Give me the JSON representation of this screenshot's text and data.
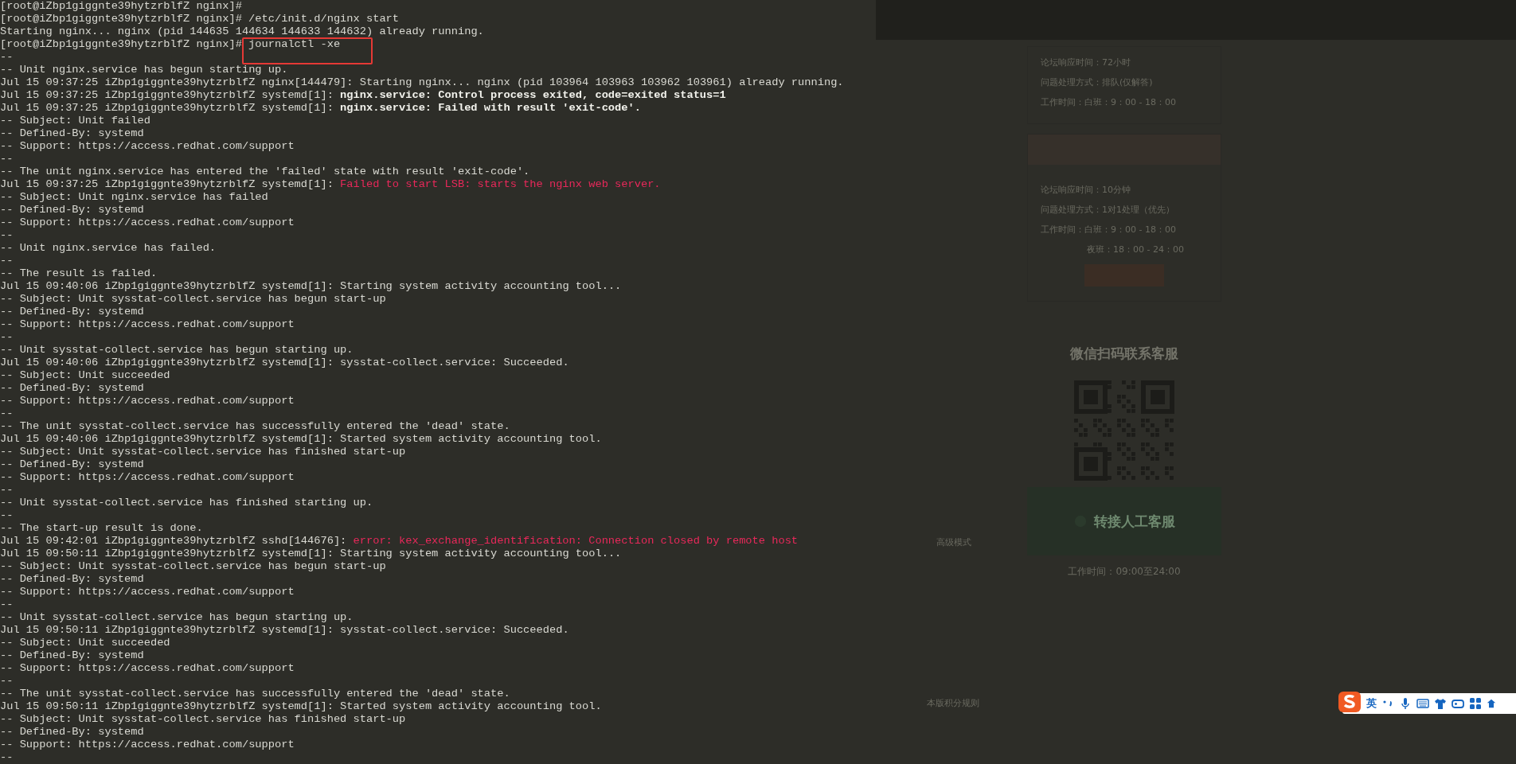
{
  "terminal": {
    "lines": [
      {
        "kind": "prompt",
        "prompt": "[root@iZbp1giggnte39hytzrblfZ nginx]#"
      },
      {
        "kind": "prompt",
        "prompt": "[root@iZbp1giggnte39hytzrblfZ nginx]#",
        "command": "/etc/init.d/nginx start",
        "boxed": false
      },
      {
        "kind": "output",
        "text": "Starting nginx... nginx (pid 144635 144634 144633 144632) already running."
      },
      {
        "kind": "prompt",
        "prompt": "[root@iZbp1giggnte39hytzrblfZ nginx]#",
        "command": "journalctl -xe",
        "boxed": true
      },
      {
        "kind": "output",
        "text": "--"
      },
      {
        "kind": "output",
        "text": "-- Unit nginx.service has begun starting up."
      },
      {
        "kind": "output",
        "text": "Jul 15 09:37:25 iZbp1giggnte39hytzrblfZ nginx[144479]: Starting nginx... nginx (pid 103964 103963 103962 103961) already running."
      },
      {
        "kind": "log",
        "prefix": "Jul 15 09:37:25 iZbp1giggnte39hytzrblfZ systemd[1]:",
        "message": "nginx.service: Control process exited, code=exited status=1",
        "bold": true,
        "error": false
      },
      {
        "kind": "log",
        "prefix": "Jul 15 09:37:25 iZbp1giggnte39hytzrblfZ systemd[1]:",
        "message": "nginx.service: Failed with result 'exit-code'.",
        "bold": true,
        "error": false
      },
      {
        "kind": "output",
        "text": "-- Subject: Unit failed"
      },
      {
        "kind": "output",
        "text": "-- Defined-By: systemd"
      },
      {
        "kind": "output",
        "text": "-- Support: https://access.redhat.com/support"
      },
      {
        "kind": "output",
        "text": "--"
      },
      {
        "kind": "output",
        "text": "-- The unit nginx.service has entered the 'failed' state with result 'exit-code'."
      },
      {
        "kind": "log",
        "prefix": "Jul 15 09:37:25 iZbp1giggnte39hytzrblfZ systemd[1]:",
        "message": "Failed to start LSB: starts the nginx web server.",
        "bold": false,
        "error": true
      },
      {
        "kind": "output",
        "text": "-- Subject: Unit nginx.service has failed"
      },
      {
        "kind": "output",
        "text": "-- Defined-By: systemd"
      },
      {
        "kind": "output",
        "text": "-- Support: https://access.redhat.com/support"
      },
      {
        "kind": "output",
        "text": "--"
      },
      {
        "kind": "output",
        "text": "-- Unit nginx.service has failed."
      },
      {
        "kind": "output",
        "text": "--"
      },
      {
        "kind": "output",
        "text": "-- The result is failed."
      },
      {
        "kind": "output",
        "text": "Jul 15 09:40:06 iZbp1giggnte39hytzrblfZ systemd[1]: Starting system activity accounting tool..."
      },
      {
        "kind": "output",
        "text": "-- Subject: Unit sysstat-collect.service has begun start-up"
      },
      {
        "kind": "output",
        "text": "-- Defined-By: systemd"
      },
      {
        "kind": "output",
        "text": "-- Support: https://access.redhat.com/support"
      },
      {
        "kind": "output",
        "text": "--"
      },
      {
        "kind": "output",
        "text": "-- Unit sysstat-collect.service has begun starting up."
      },
      {
        "kind": "output",
        "text": "Jul 15 09:40:06 iZbp1giggnte39hytzrblfZ systemd[1]: sysstat-collect.service: Succeeded."
      },
      {
        "kind": "output",
        "text": "-- Subject: Unit succeeded"
      },
      {
        "kind": "output",
        "text": "-- Defined-By: systemd"
      },
      {
        "kind": "output",
        "text": "-- Support: https://access.redhat.com/support"
      },
      {
        "kind": "output",
        "text": "--"
      },
      {
        "kind": "output",
        "text": "-- The unit sysstat-collect.service has successfully entered the 'dead' state."
      },
      {
        "kind": "output",
        "text": "Jul 15 09:40:06 iZbp1giggnte39hytzrblfZ systemd[1]: Started system activity accounting tool."
      },
      {
        "kind": "output",
        "text": "-- Subject: Unit sysstat-collect.service has finished start-up"
      },
      {
        "kind": "output",
        "text": "-- Defined-By: systemd"
      },
      {
        "kind": "output",
        "text": "-- Support: https://access.redhat.com/support"
      },
      {
        "kind": "output",
        "text": "--"
      },
      {
        "kind": "output",
        "text": "-- Unit sysstat-collect.service has finished starting up."
      },
      {
        "kind": "output",
        "text": "--"
      },
      {
        "kind": "output",
        "text": "-- The start-up result is done."
      },
      {
        "kind": "log",
        "prefix": "Jul 15 09:42:01 iZbp1giggnte39hytzrblfZ sshd[144676]:",
        "message": "error: kex_exchange_identification: Connection closed by remote host",
        "bold": false,
        "error": true
      },
      {
        "kind": "output",
        "text": "Jul 15 09:50:11 iZbp1giggnte39hytzrblfZ systemd[1]: Starting system activity accounting tool..."
      },
      {
        "kind": "output",
        "text": "-- Subject: Unit sysstat-collect.service has begun start-up"
      },
      {
        "kind": "output",
        "text": "-- Defined-By: systemd"
      },
      {
        "kind": "output",
        "text": "-- Support: https://access.redhat.com/support"
      },
      {
        "kind": "output",
        "text": "--"
      },
      {
        "kind": "output",
        "text": "-- Unit sysstat-collect.service has begun starting up."
      },
      {
        "kind": "output",
        "text": "Jul 15 09:50:11 iZbp1giggnte39hytzrblfZ systemd[1]: sysstat-collect.service: Succeeded."
      },
      {
        "kind": "output",
        "text": "-- Subject: Unit succeeded"
      },
      {
        "kind": "output",
        "text": "-- Defined-By: systemd"
      },
      {
        "kind": "output",
        "text": "-- Support: https://access.redhat.com/support"
      },
      {
        "kind": "output",
        "text": "--"
      },
      {
        "kind": "output",
        "text": "-- The unit sysstat-collect.service has successfully entered the 'dead' state."
      },
      {
        "kind": "output",
        "text": "Jul 15 09:50:11 iZbp1giggnte39hytzrblfZ systemd[1]: Started system activity accounting tool."
      },
      {
        "kind": "output",
        "text": "-- Subject: Unit sysstat-collect.service has finished start-up"
      },
      {
        "kind": "output",
        "text": "-- Defined-By: systemd"
      },
      {
        "kind": "output",
        "text": "-- Support: https://access.redhat.com/support"
      },
      {
        "kind": "output",
        "text": "--"
      }
    ]
  },
  "background_page": {
    "sidebar": [
      "高级模式",
      "本版积分规则"
    ],
    "cards": [
      {
        "lines": [
          {
            "label": "论坛响应时间：",
            "value": "72小时"
          },
          {
            "label": "问题处理方式：",
            "value": "排队(仅解答)"
          },
          {
            "label": "工作时间：",
            "value": "白班：9：00 - 18：00"
          }
        ],
        "header": false,
        "button": false
      },
      {
        "header": true,
        "lines": [
          {
            "label": "论坛响应时间：",
            "value": "10分钟"
          },
          {
            "label": "问题处理方式：",
            "value": "1对1处理（优先）"
          },
          {
            "label": "工作时间：",
            "value": "白班：9：00 - 18：00"
          },
          {
            "value": "夜班：18：00 - 24：00"
          }
        ],
        "button": true
      }
    ],
    "wechat_heading": "微信扫码联系客服",
    "transfer_button": "转接人工客服",
    "service_hours": "工作时间：09:00至24:00"
  },
  "input_method": {
    "mode": "英"
  }
}
